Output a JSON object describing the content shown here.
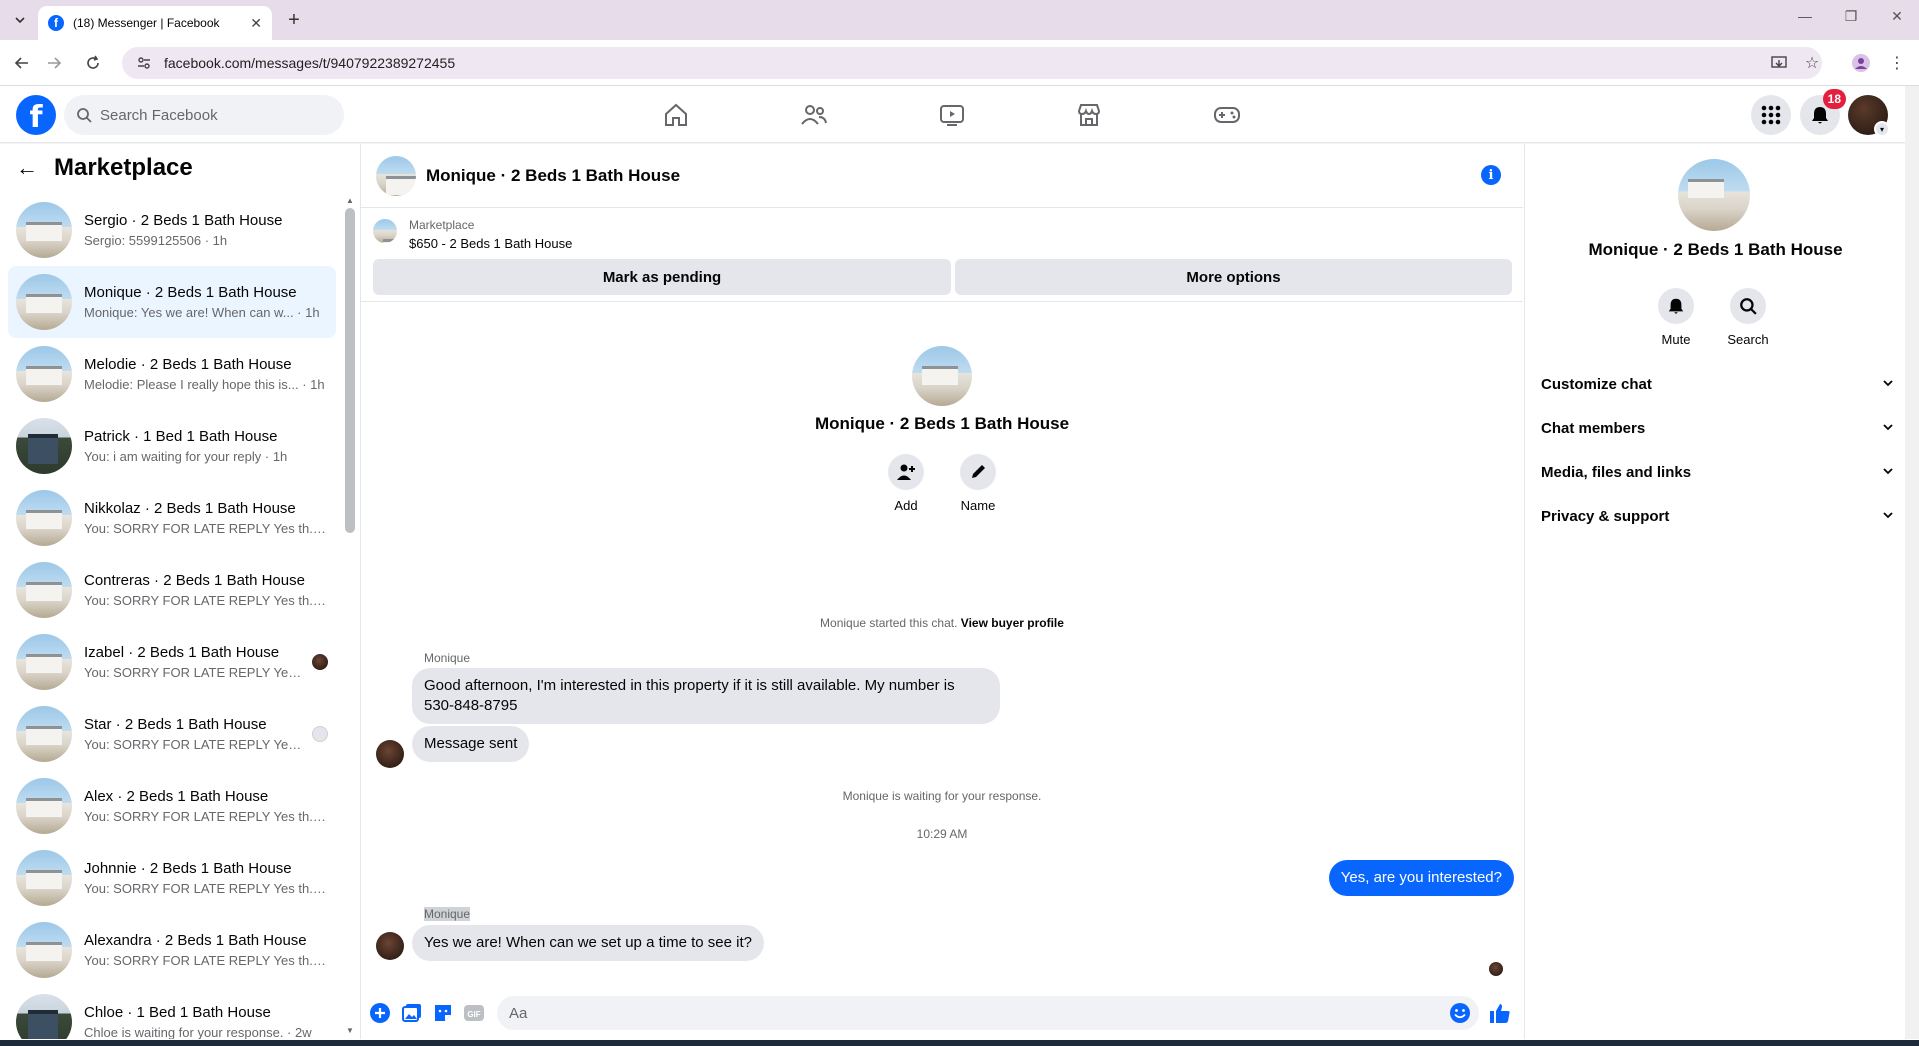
{
  "browser": {
    "tab_title": "(18) Messenger | Facebook",
    "url": "facebook.com/messages/t/9407922389272455"
  },
  "header": {
    "search_placeholder": "Search Facebook",
    "notifications_count": "18"
  },
  "sidebar": {
    "title": "Marketplace",
    "chats": [
      {
        "name": "Sergio · 2 Beds 1 Bath House",
        "snippet": "Sergio: 5599125506 · 1h",
        "avatar": "house1",
        "receipt": ""
      },
      {
        "name": "Monique · 2 Beds 1 Bath House",
        "snippet": "Monique: Yes we are! When can w... · 1h",
        "avatar": "house1",
        "receipt": "",
        "active": true
      },
      {
        "name": "Melodie · 2 Beds 1 Bath House",
        "snippet": "Melodie: Please I really hope this is... · 1h",
        "avatar": "house1",
        "receipt": ""
      },
      {
        "name": "Patrick · 1 Bed 1 Bath House",
        "snippet": "You: i am waiting for your reply · 1h",
        "avatar": "house2",
        "receipt": ""
      },
      {
        "name": "Nikkolaz · 2 Beds 1 Bath House",
        "snippet": "You: SORRY FOR LATE REPLY Yes th... · 1h",
        "avatar": "house1",
        "receipt": ""
      },
      {
        "name": "Contreras · 2 Beds 1 Bath House",
        "snippet": "You: SORRY FOR LATE REPLY Yes th... · 1h",
        "avatar": "house1",
        "receipt": ""
      },
      {
        "name": "Izabel · 2 Beds 1 Bath House",
        "snippet": "You: SORRY FOR LATE REPLY Yes... · 1h",
        "avatar": "house1",
        "receipt": "photo"
      },
      {
        "name": "Star · 2 Beds 1 Bath House",
        "snippet": "You: SORRY FOR LATE REPLY Yes... · 1h",
        "avatar": "house1",
        "receipt": "generic"
      },
      {
        "name": "Alex · 2 Beds 1 Bath House",
        "snippet": "You: SORRY FOR LATE REPLY Yes th... · 1h",
        "avatar": "house1",
        "receipt": ""
      },
      {
        "name": "Johnnie · 2 Beds 1 Bath House",
        "snippet": "You: SORRY FOR LATE REPLY Yes th... · 1h",
        "avatar": "house1",
        "receipt": ""
      },
      {
        "name": "Alexandra · 2 Beds 1 Bath House",
        "snippet": "You: SORRY FOR LATE REPLY Yes th... · 1h",
        "avatar": "house1",
        "receipt": ""
      },
      {
        "name": "Chloe · 1 Bed 1 Bath House",
        "snippet": "Chloe is waiting for your response. · 2w",
        "avatar": "house2",
        "receipt": ""
      }
    ]
  },
  "chat": {
    "title": "Monique · 2 Beds 1 Bath House",
    "marketplace_label": "Marketplace",
    "listing": "$650 - 2 Beds 1 Bath House",
    "mark_pending": "Mark as pending",
    "more_options": "More options",
    "intro_name": "Monique · 2 Beds 1 Bath House",
    "add_label": "Add",
    "name_label": "Name",
    "started_prefix": "Monique started this chat.",
    "view_profile": "View buyer profile",
    "sender": "Monique",
    "msg1": "Good afternoon, I'm interested in this property if it is still available. My number is 530-848-8795",
    "msg2": "Message sent",
    "waiting": "Monique is waiting for your response.",
    "time": "10:29 AM",
    "msg_out": "Yes, are you interested?",
    "sender2": "Monique",
    "msg3": "Yes we are! When can we set up a time to see it?",
    "composer_placeholder": "Aa"
  },
  "info_panel": {
    "name": "Monique · 2 Beds 1 Bath House",
    "mute": "Mute",
    "search": "Search",
    "sections": [
      "Customize chat",
      "Chat members",
      "Media, files and links",
      "Privacy & support"
    ]
  },
  "colors": {
    "brand": "#0866ff",
    "badge": "#e41e3f",
    "active_row": "#ebf5ff"
  }
}
